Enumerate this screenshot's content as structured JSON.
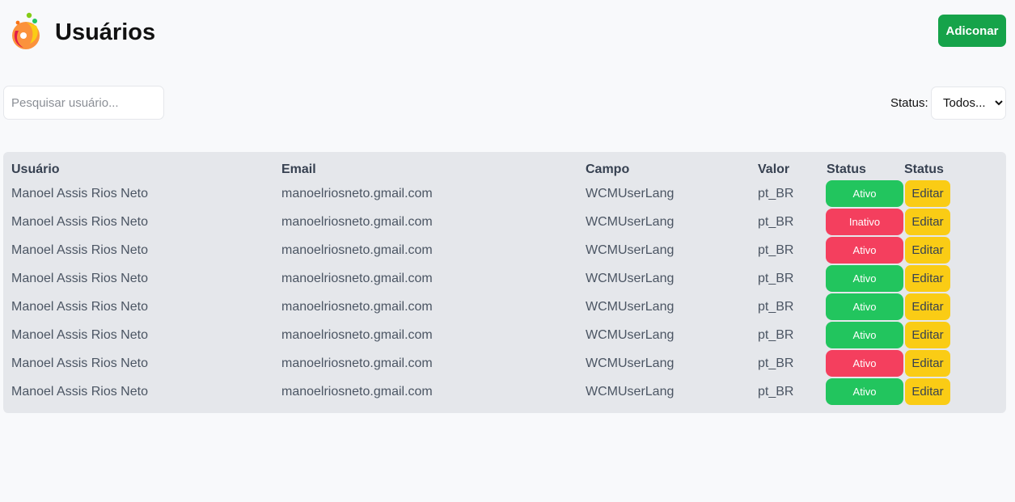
{
  "header": {
    "title": "Usuários",
    "add_button": "Adiconar"
  },
  "filters": {
    "search_placeholder": "Pesquisar usuário...",
    "status_label": "Status:",
    "status_selected": "Todos..."
  },
  "table": {
    "columns": [
      "Usuário",
      "Email",
      "Campo",
      "Valor",
      "Status",
      "Status"
    ],
    "edit_label": "Editar",
    "colors": {
      "active": "#22c55e",
      "inactive": "#f43f5e",
      "edit": "#facc15",
      "add": "#16a34a"
    },
    "rows": [
      {
        "user": "Manoel Assis Rios Neto",
        "email": "manoelriosneto.gmail.com",
        "field": "WCMUserLang",
        "value": "pt_BR",
        "status": "Ativo",
        "status_color": "green"
      },
      {
        "user": "Manoel Assis Rios Neto",
        "email": "manoelriosneto.gmail.com",
        "field": "WCMUserLang",
        "value": "pt_BR",
        "status": "Inativo",
        "status_color": "red"
      },
      {
        "user": "Manoel Assis Rios Neto",
        "email": "manoelriosneto.gmail.com",
        "field": "WCMUserLang",
        "value": "pt_BR",
        "status": "Ativo",
        "status_color": "red"
      },
      {
        "user": "Manoel Assis Rios Neto",
        "email": "manoelriosneto.gmail.com",
        "field": "WCMUserLang",
        "value": "pt_BR",
        "status": "Ativo",
        "status_color": "green"
      },
      {
        "user": "Manoel Assis Rios Neto",
        "email": "manoelriosneto.gmail.com",
        "field": "WCMUserLang",
        "value": "pt_BR",
        "status": "Ativo",
        "status_color": "green"
      },
      {
        "user": "Manoel Assis Rios Neto",
        "email": "manoelriosneto.gmail.com",
        "field": "WCMUserLang",
        "value": "pt_BR",
        "status": "Ativo",
        "status_color": "green"
      },
      {
        "user": "Manoel Assis Rios Neto",
        "email": "manoelriosneto.gmail.com",
        "field": "WCMUserLang",
        "value": "pt_BR",
        "status": "Ativo",
        "status_color": "red"
      },
      {
        "user": "Manoel Assis Rios Neto",
        "email": "manoelriosneto.gmail.com",
        "field": "WCMUserLang",
        "value": "pt_BR",
        "status": "Ativo",
        "status_color": "green"
      }
    ]
  }
}
